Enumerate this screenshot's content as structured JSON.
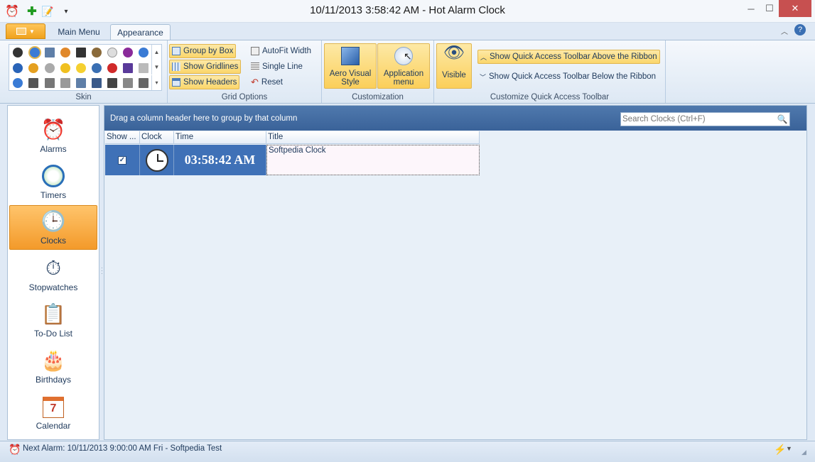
{
  "window": {
    "title": "10/11/2013 3:58:42 AM - Hot Alarm Clock"
  },
  "qat": {
    "icons": [
      "app-clock-icon",
      "add-icon",
      "edit-icon",
      "qat-dropdown-icon"
    ]
  },
  "tabs": [
    {
      "label": "Main Menu"
    },
    {
      "label": "Appearance"
    }
  ],
  "ribbon": {
    "skin": {
      "group_label": "Skin"
    },
    "grid_options": {
      "group_label": "Grid Options",
      "group_by_box": "Group by Box",
      "show_gridlines": "Show Gridlines",
      "show_headers": "Show Headers",
      "autofit_width": "AutoFit Width",
      "single_line": "Single Line",
      "reset": "Reset"
    },
    "customization": {
      "group_label": "Customization",
      "aero_line1": "Aero Visual",
      "aero_line2": "Style",
      "app_menu_line1": "Application",
      "app_menu_line2": "menu"
    },
    "qat_group": {
      "group_label": "Customize Quick Access Toolbar",
      "visible": "Visible",
      "above": "Show Quick Access Toolbar Above the Ribbon",
      "below": "Show Quick Access Toolbar Below the Ribbon"
    }
  },
  "nav": {
    "items": [
      {
        "label": "Alarms"
      },
      {
        "label": "Timers"
      },
      {
        "label": "Clocks"
      },
      {
        "label": "Stopwatches"
      },
      {
        "label": "To-Do List"
      },
      {
        "label": "Birthdays"
      },
      {
        "label": "Calendar"
      }
    ],
    "selected": "Clocks"
  },
  "grid": {
    "group_hint": "Drag a column header here to group by that column",
    "search_placeholder": "Search Clocks (Ctrl+F)",
    "columns": [
      "Show ...",
      "Clock",
      "Time",
      "Title"
    ],
    "rows": [
      {
        "show": true,
        "time": "03:58:42 AM",
        "title": "Softpedia Clock"
      }
    ]
  },
  "calendar_icon_day": "7",
  "status": {
    "next_alarm": "Next Alarm: 10/11/2013 9:00:00 AM Fri - Softpedia Test"
  },
  "colors": {
    "accent": "#3f71b7",
    "selected_nav": "#f39a2a",
    "ribbon_highlight": "#fbd66b"
  }
}
